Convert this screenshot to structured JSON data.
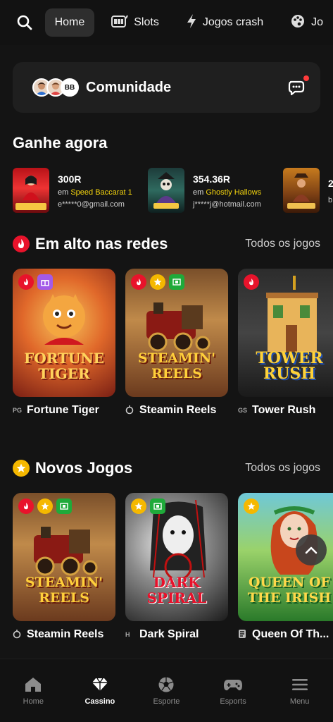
{
  "topnav": {
    "items": [
      {
        "label": "Home",
        "icon": "home",
        "active": true
      },
      {
        "label": "Slots",
        "icon": "slot-machine-icon"
      },
      {
        "label": "Jogos crash",
        "icon": "lightning-icon"
      },
      {
        "label": "Jo",
        "icon": "palette-icon"
      }
    ]
  },
  "community": {
    "title": "Comunidade",
    "avatar_bb": "BB"
  },
  "winners_section": {
    "title": "Ganhe agora"
  },
  "winners": [
    {
      "amount": "300R",
      "prefix": "em",
      "game": "Speed Baccarat 1",
      "email": "e*****0@gmail.com"
    },
    {
      "amount": "354.36R",
      "prefix": "em",
      "game": "Ghostly Hallows",
      "email": "j*****j@hotmail.com"
    },
    {
      "amount": "2",
      "prefix": "",
      "game": "",
      "email": "b"
    }
  ],
  "trending": {
    "title": "Em alto nas redes",
    "link": "Todos os jogos",
    "games": [
      {
        "name": "Fortune Tiger",
        "provider": "PG",
        "card_title": "FORTUNE TIGER"
      },
      {
        "name": "Steamin Reels",
        "provider": "",
        "card_title": "STEAMIN' REELS"
      },
      {
        "name": "Tower Rush",
        "provider": "GS",
        "card_title": "TOWER RUSH"
      }
    ]
  },
  "new_games": {
    "title": "Novos Jogos",
    "link": "Todos os jogos",
    "games": [
      {
        "name": "Steamin Reels",
        "provider": "",
        "card_title": "STEAMIN' REELS"
      },
      {
        "name": "Dark Spiral",
        "provider": "H",
        "card_title": "DARK SPIRAL"
      },
      {
        "name": "Queen Of Th...",
        "provider": "",
        "card_title": "QUEEN OF THE IRISH"
      }
    ]
  },
  "bottomnav": {
    "items": [
      {
        "label": "Home"
      },
      {
        "label": "Cassino",
        "active": true
      },
      {
        "label": "Esporte"
      },
      {
        "label": "Esports"
      },
      {
        "label": "Menu"
      }
    ]
  },
  "colors": {
    "background": "#141414",
    "accent_yellow": "#f5d50e",
    "hot_red": "#e8132b",
    "star_yellow": "#f5b800",
    "feature_green": "#1faa3a"
  }
}
